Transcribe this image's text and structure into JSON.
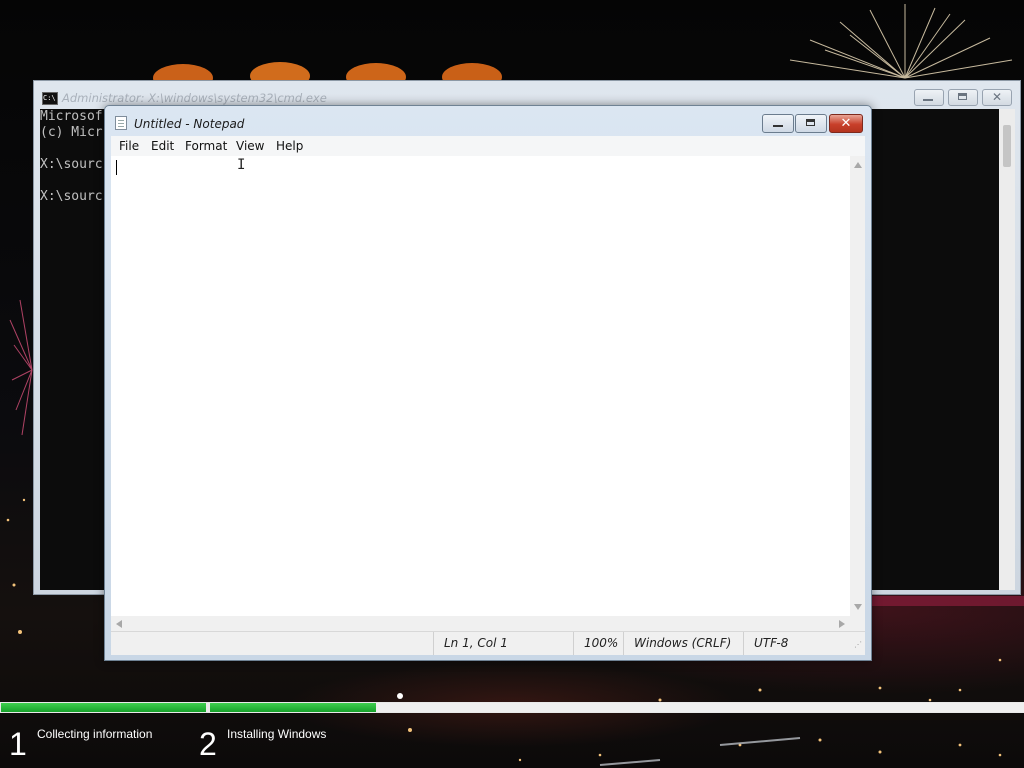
{
  "cmd_window": {
    "title": "Administrator: X:\\windows\\system32\\cmd.exe",
    "lines": [
      "Microsof",
      "(c) Micr",
      "",
      "X:\\sourc",
      "",
      "X:\\sourc"
    ]
  },
  "notepad": {
    "title": "Untitled - Notepad",
    "menu": [
      "File",
      "Edit",
      "Format",
      "View",
      "Help"
    ],
    "content": "",
    "status": {
      "position": "Ln 1, Col 1",
      "zoom": "100%",
      "line_ending": "Windows (CRLF)",
      "encoding": "UTF-8"
    }
  },
  "setup": {
    "steps": [
      {
        "number": "1",
        "label": "Collecting information",
        "progress": 1.0
      },
      {
        "number": "2",
        "label": "Installing Windows",
        "progress": 0.2
      }
    ],
    "progress_color": "#1fb233"
  }
}
